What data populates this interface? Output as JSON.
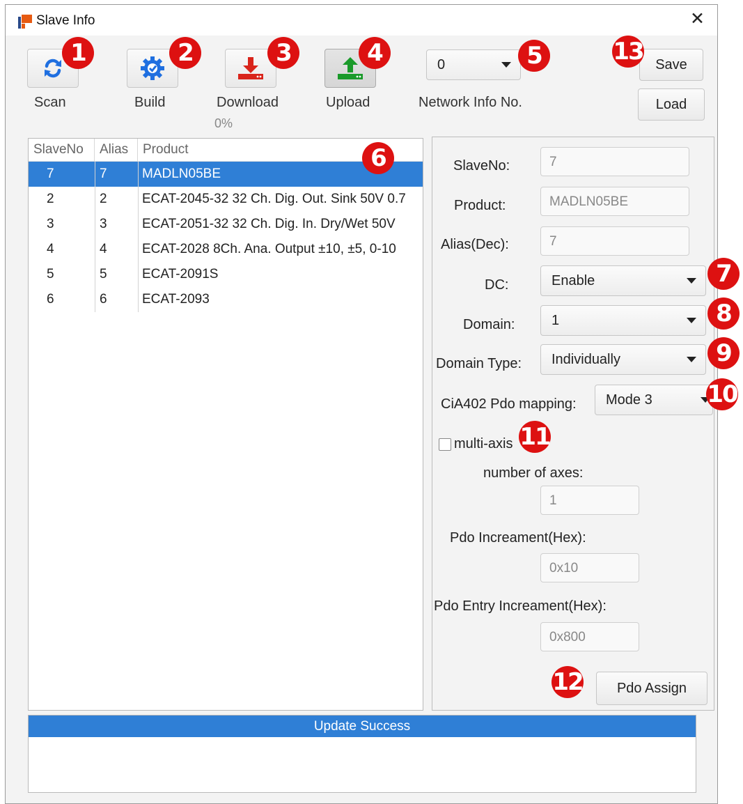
{
  "window": {
    "title": "Slave Info",
    "close_label": "✕"
  },
  "toolbar": {
    "scan": {
      "label": "Scan",
      "icon": "refresh-icon",
      "color": "#1f6fe0"
    },
    "build": {
      "label": "Build",
      "icon": "gear-icon",
      "color": "#1f6fe0"
    },
    "download": {
      "label": "Download",
      "icon": "download-icon",
      "color": "#d9241b",
      "progress": "0%"
    },
    "upload": {
      "label": "Upload",
      "icon": "upload-icon",
      "color": "#1a9a2a"
    },
    "network_info_value": "0",
    "network_info_label": "Network Info No.",
    "save_label": "Save",
    "load_label": "Load"
  },
  "slave_list": {
    "columns": [
      "SlaveNo",
      "Alias",
      "Product"
    ],
    "rows": [
      {
        "slave_no": "7",
        "alias": "7",
        "product": "MADLN05BE",
        "selected": true
      },
      {
        "slave_no": "2",
        "alias": "2",
        "product": "ECAT-2045-32 32 Ch. Dig. Out. Sink 50V 0.7"
      },
      {
        "slave_no": "3",
        "alias": "3",
        "product": "ECAT-2051-32 32 Ch. Dig. In. Dry/Wet 50V"
      },
      {
        "slave_no": "4",
        "alias": "4",
        "product": "ECAT-2028 8Ch. Ana. Output ±10, ±5, 0-10"
      },
      {
        "slave_no": "5",
        "alias": "5",
        "product": "ECAT-2091S"
      },
      {
        "slave_no": "6",
        "alias": "6",
        "product": "ECAT-2093"
      }
    ]
  },
  "details": {
    "slave_no_label": "SlaveNo:",
    "slave_no_value": "7",
    "product_label": "Product:",
    "product_value": "MADLN05BE",
    "alias_label": "Alias(Dec):",
    "alias_value": "7",
    "dc_label": "DC:",
    "dc_value": "Enable",
    "domain_label": "Domain:",
    "domain_value": "1",
    "domain_type_label": "Domain Type:",
    "domain_type_value": "Individually",
    "cia402_label": "CiA402 Pdo mapping:",
    "cia402_value": "Mode 3",
    "multi_axis_label": "multi-axis",
    "multi_axis_checked": false,
    "num_axes_label": "number of axes:",
    "num_axes_value": "1",
    "pdo_inc_label": "Pdo Increament(Hex):",
    "pdo_inc_value": "0x10",
    "pdo_entry_inc_label": "Pdo Entry Increament(Hex):",
    "pdo_entry_inc_value": "0x800",
    "pdo_assign_label": "Pdo Assign"
  },
  "status": {
    "message": "Update Success"
  },
  "badges": [
    "1",
    "2",
    "3",
    "4",
    "5",
    "6",
    "7",
    "8",
    "9",
    "10",
    "11",
    "12",
    "13"
  ],
  "colors": {
    "selection": "#2f7fd6",
    "badge": "#dd1111"
  }
}
